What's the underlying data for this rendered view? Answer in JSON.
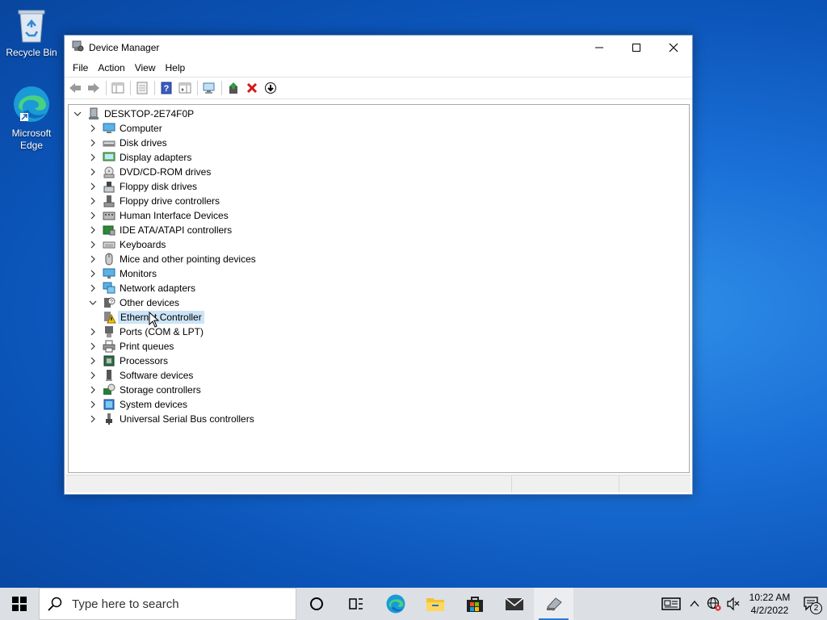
{
  "desktop": {
    "recycle_bin": "Recycle Bin",
    "edge_line1": "Microsoft",
    "edge_line2": "Edge"
  },
  "window": {
    "title": "Device Manager",
    "menu": [
      "File",
      "Action",
      "View",
      "Help"
    ]
  },
  "tree": {
    "root": "DESKTOP-2E74F0P",
    "items": [
      {
        "label": "Computer",
        "icon": "computer-icon",
        "expanded": false
      },
      {
        "label": "Disk drives",
        "icon": "disk-drive-icon",
        "expanded": false
      },
      {
        "label": "Display adapters",
        "icon": "display-adapter-icon",
        "expanded": false
      },
      {
        "label": "DVD/CD-ROM drives",
        "icon": "dvd-drive-icon",
        "expanded": false
      },
      {
        "label": "Floppy disk drives",
        "icon": "floppy-disk-icon",
        "expanded": false
      },
      {
        "label": "Floppy drive controllers",
        "icon": "floppy-controller-icon",
        "expanded": false
      },
      {
        "label": "Human Interface Devices",
        "icon": "hid-icon",
        "expanded": false
      },
      {
        "label": "IDE ATA/ATAPI controllers",
        "icon": "ide-controller-icon",
        "expanded": false
      },
      {
        "label": "Keyboards",
        "icon": "keyboard-icon",
        "expanded": false
      },
      {
        "label": "Mice and other pointing devices",
        "icon": "mouse-icon",
        "expanded": false
      },
      {
        "label": "Monitors",
        "icon": "monitor-icon",
        "expanded": false
      },
      {
        "label": "Network adapters",
        "icon": "network-adapter-icon",
        "expanded": false
      },
      {
        "label": "Other devices",
        "icon": "other-devices-icon",
        "expanded": true
      },
      {
        "label": "Ethernet Controller",
        "icon": "warning-device-icon",
        "child": true,
        "selected": true
      },
      {
        "label": "Ports (COM & LPT)",
        "icon": "port-icon",
        "expanded": false
      },
      {
        "label": "Print queues",
        "icon": "printer-icon",
        "expanded": false
      },
      {
        "label": "Processors",
        "icon": "processor-icon",
        "expanded": false
      },
      {
        "label": "Software devices",
        "icon": "software-device-icon",
        "expanded": false
      },
      {
        "label": "Storage controllers",
        "icon": "storage-controller-icon",
        "expanded": false
      },
      {
        "label": "System devices",
        "icon": "system-devices-icon",
        "expanded": false
      },
      {
        "label": "Universal Serial Bus controllers",
        "icon": "usb-icon",
        "expanded": false
      }
    ]
  },
  "taskbar": {
    "search_placeholder": "Type here to search",
    "time": "10:22 AM",
    "date": "4/2/2022",
    "notification_count": "2"
  },
  "colors": {
    "selection": "#cce4f7",
    "taskbar": "#dcdfe4",
    "accent": "#2f7ad6"
  }
}
